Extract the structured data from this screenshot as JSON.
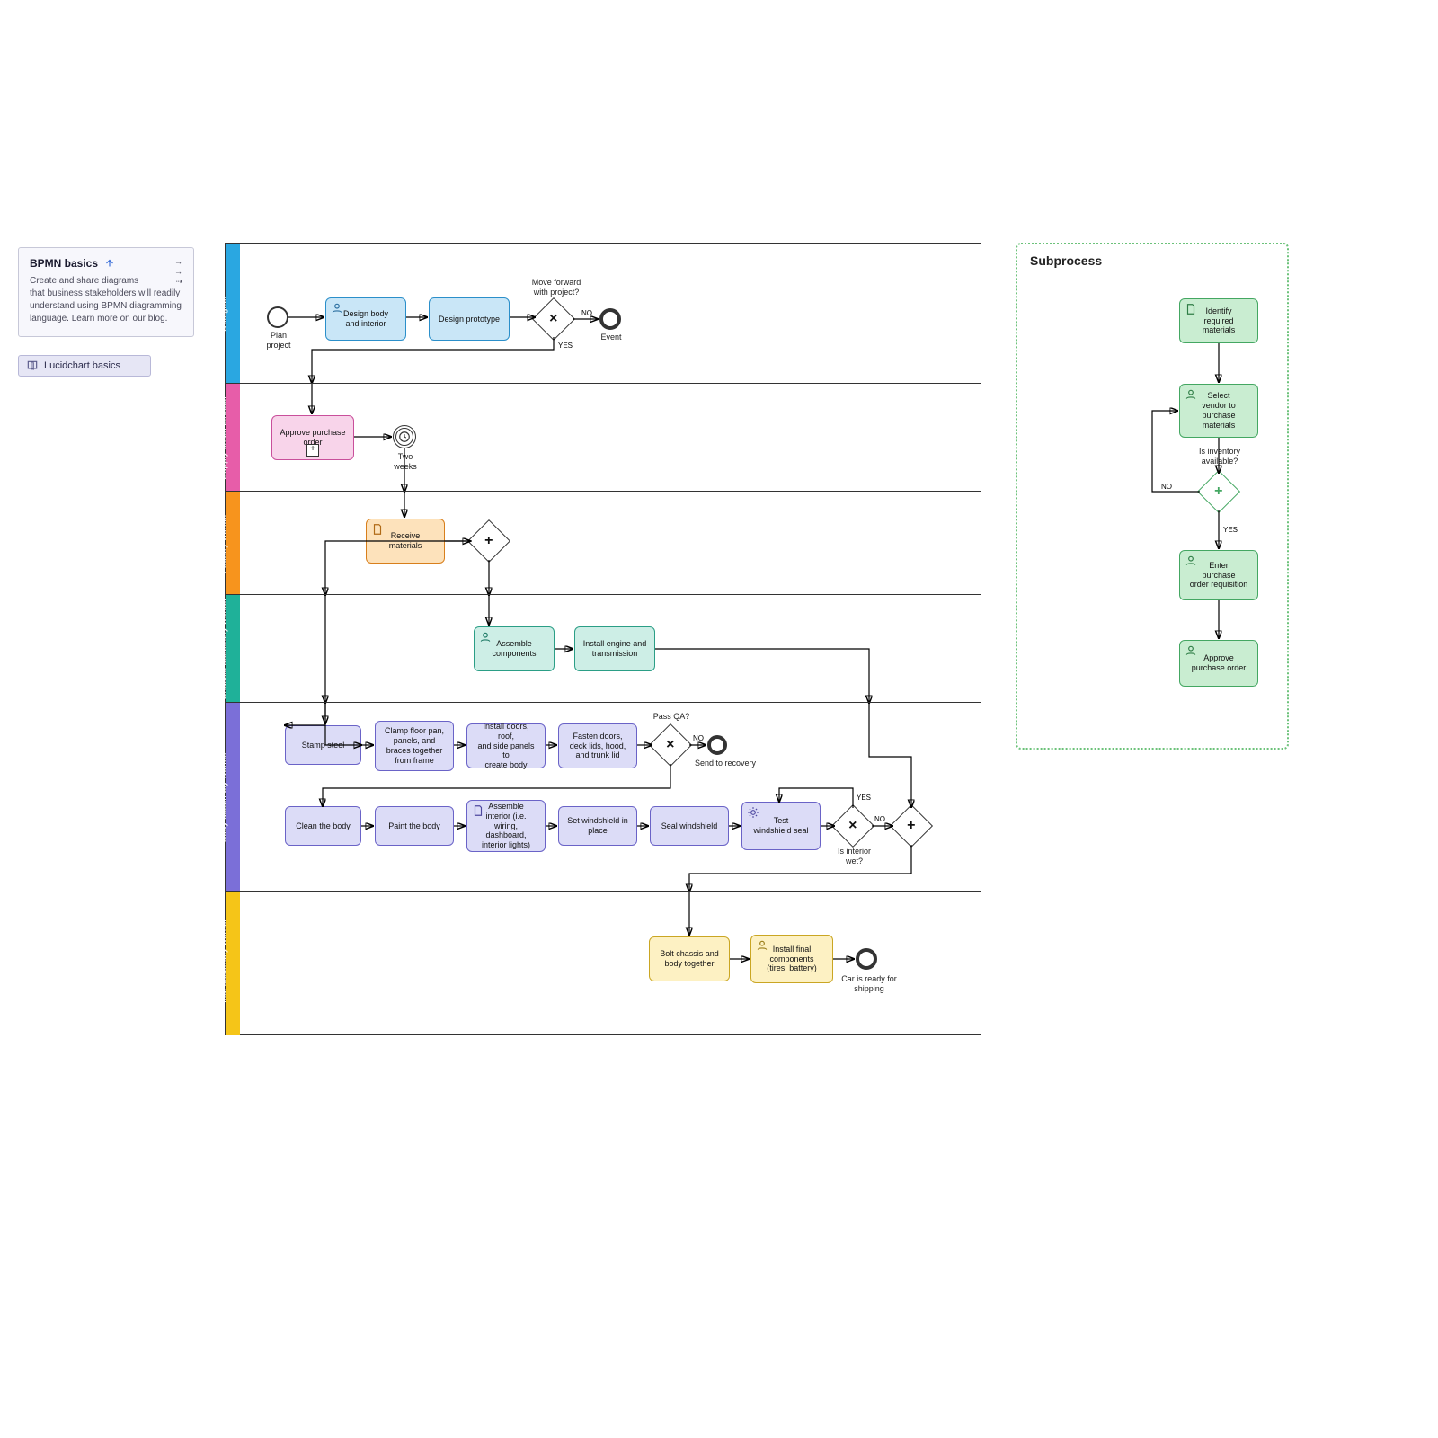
{
  "sidebar": {
    "note1": {
      "title": "BPMN basics",
      "body": "Create and share diagrams that business stakeholders will readily understand using BPMN diagramming language. Learn more on our blog."
    },
    "note2": {
      "title": "Lucidchart basics"
    }
  },
  "pool": {
    "lanes": [
      {
        "title": "Designer"
      },
      {
        "title": "Supply chain director"
      },
      {
        "title": "Factory worker"
      },
      {
        "title": "Chassis assembly worker"
      },
      {
        "title": "Body assembly worker"
      },
      {
        "title": "Final assembly worker"
      }
    ]
  },
  "nodes": {
    "plan_project": "Plan\nproject",
    "design_body": "Design body\nand interior",
    "design_proto": "Design prototype",
    "move_forward_q": "Move forward\nwith project?",
    "event_end": "Event",
    "approve_po": "Approve purchase\norder",
    "two_weeks": "Two\nweeks",
    "receive_materials": "Receive\nmaterials",
    "assemble_components": "Assemble\ncomponents",
    "install_engine": "Install engine and\ntransmission",
    "stamp_steel": "Stamp steel",
    "clamp_floor": "Clamp floor pan,\npanels, and\nbraces together\nfrom frame",
    "install_doors": "Install doors, roof,\nand side panels to\ncreate body",
    "fasten_doors": "Fasten doors,\ndeck lids, hood,\nand trunk lid",
    "pass_qa_q": "Pass QA?",
    "send_recovery": "Send to recovery",
    "clean_body": "Clean the body",
    "paint_body": "Paint the body",
    "assemble_interior": "Assemble\ninterior (i.e.\nwiring, dashboard,\ninterior lights)",
    "set_windshield": "Set windshield in\nplace",
    "seal_windshield": "Seal windshield",
    "test_windshield": "Test\nwindshield seal",
    "interior_wet_q": "Is interior\nwet?",
    "bolt_chassis": "Bolt chassis and\nbody together",
    "install_final": "Install final\ncomponents\n(tires, battery)",
    "ready_ship": "Car is ready for\nshipping",
    "yes": "YES",
    "no": "NO"
  },
  "subprocess": {
    "title": "Subprocess",
    "identify": "Identify\nrequired materials",
    "select_vendor": "Select\nvendor to\npurchase\nmaterials",
    "inventory_q": "Is inventory\navailable?",
    "enter_por": "Enter\npurchase\norder requisition",
    "approve_po": "Approve\npurchase order",
    "yes": "YES",
    "no": "NO"
  }
}
